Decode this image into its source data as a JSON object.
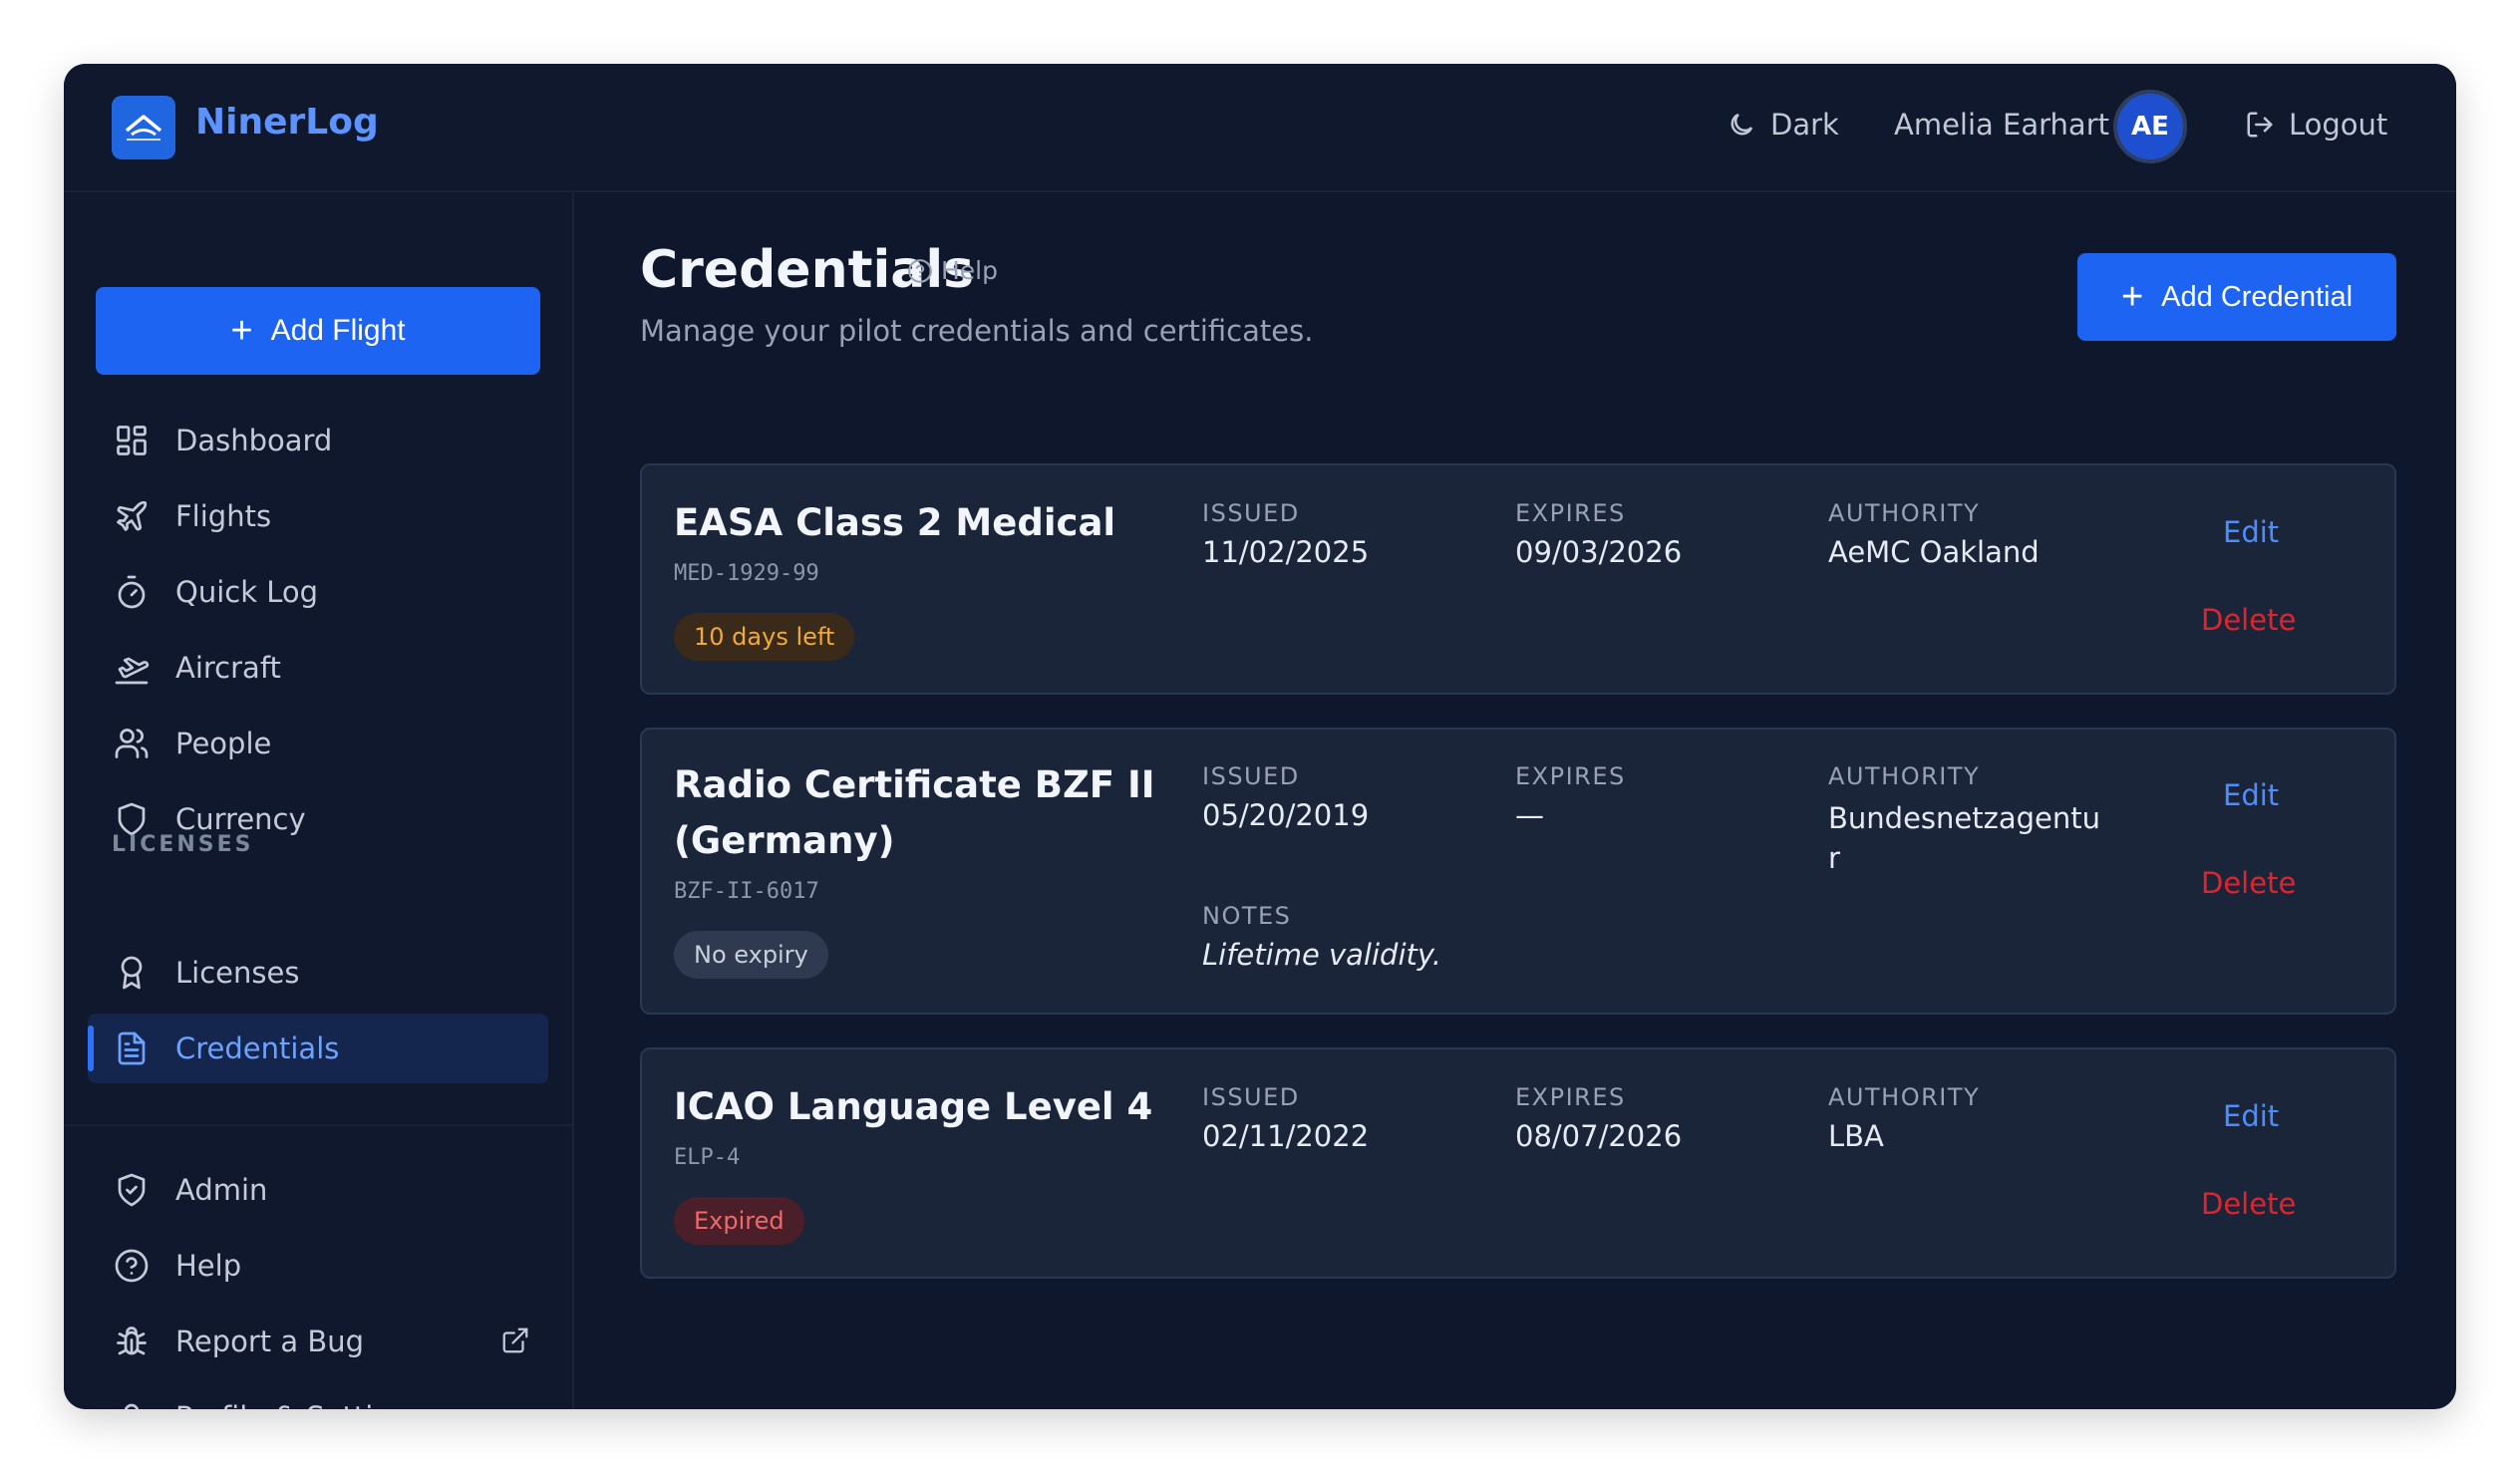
{
  "app": {
    "brand": "NinerLog"
  },
  "header": {
    "theme_label": "Dark",
    "user_name": "Amelia Earhart",
    "user_initials": "AE",
    "logout_label": "Logout"
  },
  "sidebar": {
    "add_flight_label": "Add Flight",
    "items": [
      {
        "label": "Dashboard",
        "icon": "dashboard-icon"
      },
      {
        "label": "Flights",
        "icon": "plane-icon"
      },
      {
        "label": "Quick Log",
        "icon": "stopwatch-icon"
      },
      {
        "label": "Aircraft",
        "icon": "takeoff-icon"
      },
      {
        "label": "People",
        "icon": "users-icon"
      },
      {
        "label": "Currency",
        "icon": "shield-icon"
      }
    ],
    "section_label": "LICENSES",
    "license_items": [
      {
        "label": "Licenses",
        "icon": "award-icon"
      },
      {
        "label": "Credentials",
        "icon": "document-icon",
        "active": true
      }
    ],
    "footer_items": [
      {
        "label": "Admin",
        "icon": "shield-check-icon"
      },
      {
        "label": "Help",
        "icon": "help-circle-icon"
      },
      {
        "label": "Report a Bug",
        "icon": "bug-icon"
      },
      {
        "label": "Profile & Settings",
        "icon": "user-icon"
      }
    ]
  },
  "main": {
    "title": "Credentials",
    "help_label": "Help",
    "subtitle": "Manage your pilot credentials and certificates.",
    "add_credential_label": "Add Credential",
    "labels": {
      "issued": "ISSUED",
      "expires": "EXPIRES",
      "authority": "AUTHORITY",
      "notes": "NOTES",
      "edit": "Edit",
      "delete": "Delete"
    },
    "credentials": [
      {
        "title": "EASA Class 2 Medical",
        "code": "MED-1929-99",
        "badge": "10 days left",
        "issued": "11/02/2025",
        "expires": "09/03/2026",
        "authority": "AeMC Oakland"
      },
      {
        "title": "Radio Certificate BZF II (Germany)",
        "code": "BZF-II-6017",
        "badge": "No expiry",
        "issued": "05/20/2019",
        "expires": "—",
        "authority": "Bundesnetzagentur",
        "notes": "Lifetime validity."
      },
      {
        "title": "ICAO Language Level 4",
        "code": "ELP-4",
        "badge": "Expired",
        "issued": "02/11/2022",
        "expires": "08/07/2026",
        "authority": "LBA"
      }
    ]
  },
  "colors": {
    "accent": "#1d64f2",
    "background": "#0e172b",
    "card": "#1b2539",
    "warning": "#f2a93b",
    "danger": "#e0242e",
    "link": "#4c8dff"
  }
}
